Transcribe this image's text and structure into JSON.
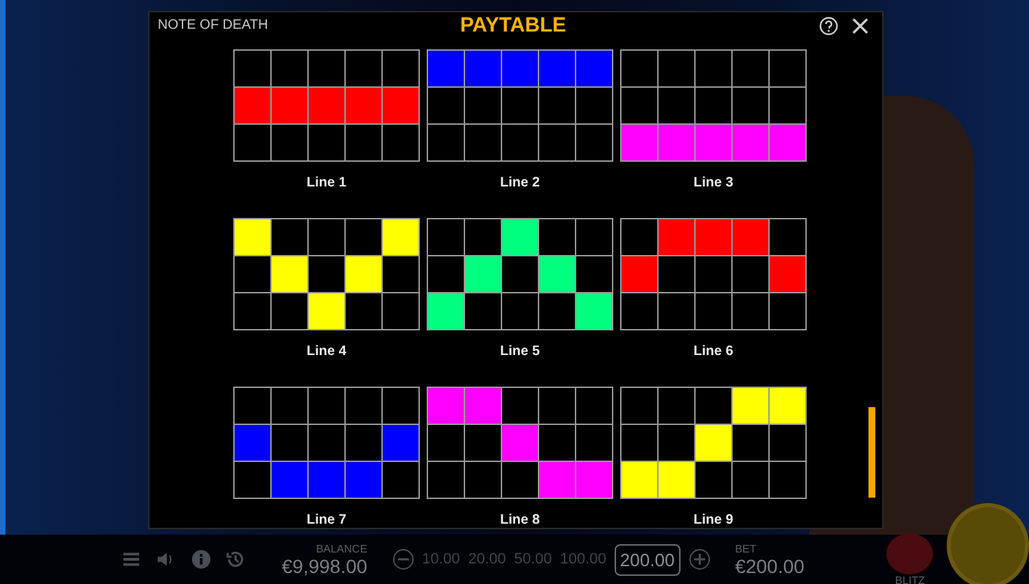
{
  "game_title": "NOTE OF DEATH",
  "title": "PAYTABLE",
  "paylines": [
    {
      "label": "Line 1",
      "color": "#ff0000",
      "rows": [
        [
          false,
          false,
          false,
          false,
          false
        ],
        [
          true,
          true,
          true,
          true,
          true
        ],
        [
          false,
          false,
          false,
          false,
          false
        ]
      ]
    },
    {
      "label": "Line 2",
      "color": "#0000ff",
      "rows": [
        [
          true,
          true,
          true,
          true,
          true
        ],
        [
          false,
          false,
          false,
          false,
          false
        ],
        [
          false,
          false,
          false,
          false,
          false
        ]
      ]
    },
    {
      "label": "Line 3",
      "color": "#ff00ff",
      "rows": [
        [
          false,
          false,
          false,
          false,
          false
        ],
        [
          false,
          false,
          false,
          false,
          false
        ],
        [
          true,
          true,
          true,
          true,
          true
        ]
      ]
    },
    {
      "label": "Line 4",
      "color": "#ffff00",
      "rows": [
        [
          true,
          false,
          false,
          false,
          true
        ],
        [
          false,
          true,
          false,
          true,
          false
        ],
        [
          false,
          false,
          true,
          false,
          false
        ]
      ]
    },
    {
      "label": "Line 5",
      "color": "#00ff7f",
      "rows": [
        [
          false,
          false,
          true,
          false,
          false
        ],
        [
          false,
          true,
          false,
          true,
          false
        ],
        [
          true,
          false,
          false,
          false,
          true
        ]
      ]
    },
    {
      "label": "Line 6",
      "color": "#ff0000",
      "rows": [
        [
          false,
          true,
          true,
          true,
          false
        ],
        [
          true,
          false,
          false,
          false,
          true
        ],
        [
          false,
          false,
          false,
          false,
          false
        ]
      ]
    },
    {
      "label": "Line 7",
      "color": "#0000ff",
      "rows": [
        [
          false,
          false,
          false,
          false,
          false
        ],
        [
          true,
          false,
          false,
          false,
          true
        ],
        [
          false,
          true,
          true,
          true,
          false
        ]
      ]
    },
    {
      "label": "Line 8",
      "color": "#ff00ff",
      "rows": [
        [
          true,
          true,
          false,
          false,
          false
        ],
        [
          false,
          false,
          true,
          false,
          false
        ],
        [
          false,
          false,
          false,
          true,
          true
        ]
      ]
    },
    {
      "label": "Line 9",
      "color": "#ffff00",
      "rows": [
        [
          false,
          false,
          false,
          true,
          true
        ],
        [
          false,
          false,
          true,
          false,
          false
        ],
        [
          true,
          true,
          false,
          false,
          false
        ]
      ]
    }
  ],
  "bottom_bar": {
    "balance_label": "BALANCE",
    "balance": "€9,998.00",
    "bet_options": [
      {
        "label": "10.00",
        "selected": false
      },
      {
        "label": "20.00",
        "selected": false
      },
      {
        "label": "50.00",
        "selected": false
      },
      {
        "label": "100.00",
        "selected": false
      },
      {
        "label": "200.00",
        "selected": true
      }
    ],
    "bet_label": "BET",
    "bet": "€200.00",
    "blitz_label": "BLITZ"
  }
}
